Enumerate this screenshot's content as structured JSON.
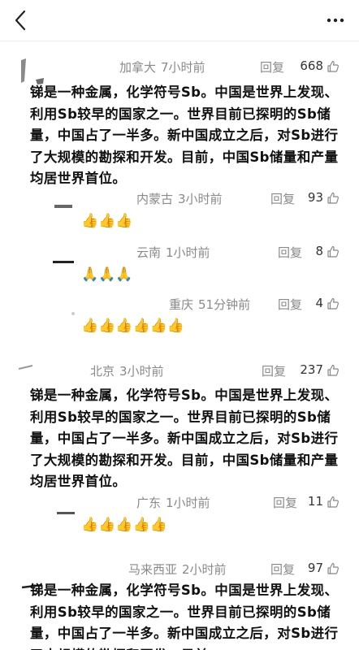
{
  "comments": [
    {
      "location": "加拿大",
      "time": "7小时前",
      "reply_label": "回复",
      "likes": "668",
      "text": "锑是一种金属，化学符号Sb。中国是世界上发现、利用Sb较早的国家之一。世界目前已探明的Sb储量，中国占了一半多。新中国成立之后，对Sb进行了大规模的勘探和开发。目前，中国Sb储量和产量均居世界首位。",
      "replies": [
        {
          "location": "内蒙古",
          "time": "3小时前",
          "reply_label": "回复",
          "likes": "93",
          "emoji": "👍👍👍"
        },
        {
          "location": "云南",
          "time": "1小时前",
          "reply_label": "回复",
          "likes": "8",
          "emoji": "🙏🙏🙏"
        },
        {
          "location": "重庆",
          "time": "51分钟前",
          "reply_label": "回复",
          "likes": "4",
          "emoji": "👍👍👍👍👍👍"
        }
      ]
    },
    {
      "location": "北京",
      "time": "3小时前",
      "reply_label": "回复",
      "likes": "237",
      "text": "锑是一种金属，化学符号Sb。中国是世界上发现、利用Sb较早的国家之一。世界目前已探明的Sb储量，中国占了一半多。新中国成立之后，对Sb进行了大规模的勘探和开发。目前，中国Sb储量和产量均居世界首位。",
      "replies": [
        {
          "location": "广东",
          "time": "1小时前",
          "reply_label": "回复",
          "likes": "11",
          "emoji": "👍👍👍👍👍"
        }
      ]
    },
    {
      "location": "马来西亚",
      "time": "2小时前",
      "reply_label": "回复",
      "likes": "97",
      "text": "锑是一种金属，化学符号Sb。中国是世界上发现、利用Sb较早的国家之一。世界目前已探明的Sb储量，中国占了一半多。新中国成立之后，对Sb进行了大规模的勘探和开发。目前，"
    }
  ],
  "icons": {
    "back": "back-chevron-icon",
    "more": "more-dots-icon",
    "like": "thumbs-up-outline-icon"
  }
}
